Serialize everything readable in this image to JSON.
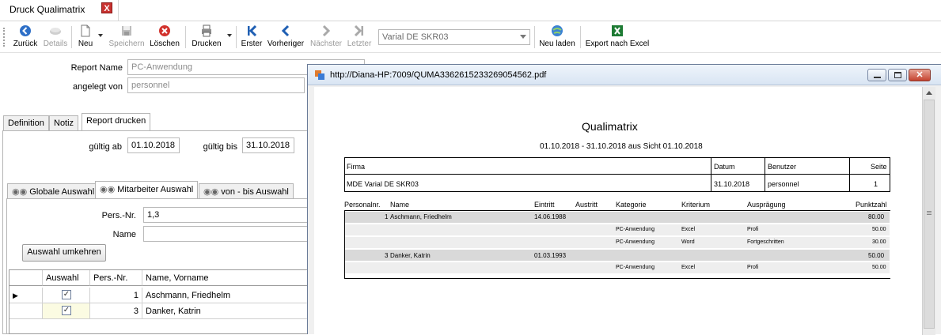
{
  "doc_tab": {
    "title": "Druck Qualimatrix",
    "close": "X"
  },
  "toolbar": {
    "back": "Zurück",
    "details": "Details",
    "new": "Neu",
    "save": "Speichern",
    "delete": "Löschen",
    "print": "Drucken",
    "first": "Erster",
    "prev": "Vorheriger",
    "next": "Nächster",
    "last": "Letzter",
    "company_value": "Varial  DE SKR03",
    "reload": "Neu laden",
    "export": "Export nach Excel"
  },
  "form": {
    "report_name_label": "Report Name",
    "report_name_value": "PC-Anwendung",
    "created_by_label": "angelegt von",
    "created_by_value": "personnel"
  },
  "tabs": [
    "Definition",
    "Notiz",
    "Report drucken"
  ],
  "report_tab": {
    "valid_from_label": "gültig ab",
    "valid_from": "01.10.2018",
    "valid_to_label": "gültig bis",
    "valid_to": "31.10.2018"
  },
  "subtabs": [
    "Globale Auswahl",
    "Mitarbeiter Auswahl",
    "von - bis Auswahl"
  ],
  "employee_select": {
    "persnr_label": "Pers.-Nr.",
    "persnr_value": "1,3",
    "name_label": "Name",
    "name_value": "",
    "invert_button": "Auswahl umkehren",
    "columns": [
      "Auswahl",
      "Pers.-Nr.",
      "Name, Vorname"
    ],
    "rows": [
      {
        "selected": true,
        "persnr": "1",
        "name": "Aschmann, Friedhelm"
      },
      {
        "selected": true,
        "persnr": "3",
        "name": "Danker, Katrin"
      }
    ]
  },
  "pdf_window": {
    "title": "http://Diana-HP:7009/QUMA3362615233269054562.pdf",
    "report": {
      "title": "Qualimatrix",
      "subtitle": "01.10.2018 - 31.10.2018 aus Sicht 01.10.2018",
      "header_labels": {
        "firma": "Firma",
        "datum": "Datum",
        "benutzer": "Benutzer",
        "seite": "Seite"
      },
      "header_values": {
        "firma": "MDE Varial  DE SKR03",
        "datum": "31.10.2018",
        "benutzer": "personnel",
        "seite": "1"
      },
      "columns": [
        "Personalnr.",
        "Name",
        "Eintritt",
        "Austritt",
        "Kategorie",
        "Kriterium",
        "Ausprägung",
        "Punktzahl"
      ],
      "rows": [
        {
          "type": "emp",
          "persnr": "1",
          "name": "Aschmann, Friedhelm",
          "eintritt": "14.06.1988",
          "punkte": "80.00"
        },
        {
          "type": "det",
          "kategorie": "PC-Anwendung",
          "kriterium": "Excel",
          "auspraegung": "Profi",
          "punkte": "50.00"
        },
        {
          "type": "det",
          "kategorie": "PC-Anwendung",
          "kriterium": "Word",
          "auspraegung": "Fortgeschritten",
          "punkte": "30.00"
        },
        {
          "type": "emp",
          "persnr": "3",
          "name": "Danker, Katrin",
          "eintritt": "01.03.1993",
          "punkte": "50.00"
        },
        {
          "type": "det",
          "kategorie": "PC-Anwendung",
          "kriterium": "Excel",
          "auspraegung": "Profi",
          "punkte": "50.00"
        }
      ]
    }
  }
}
